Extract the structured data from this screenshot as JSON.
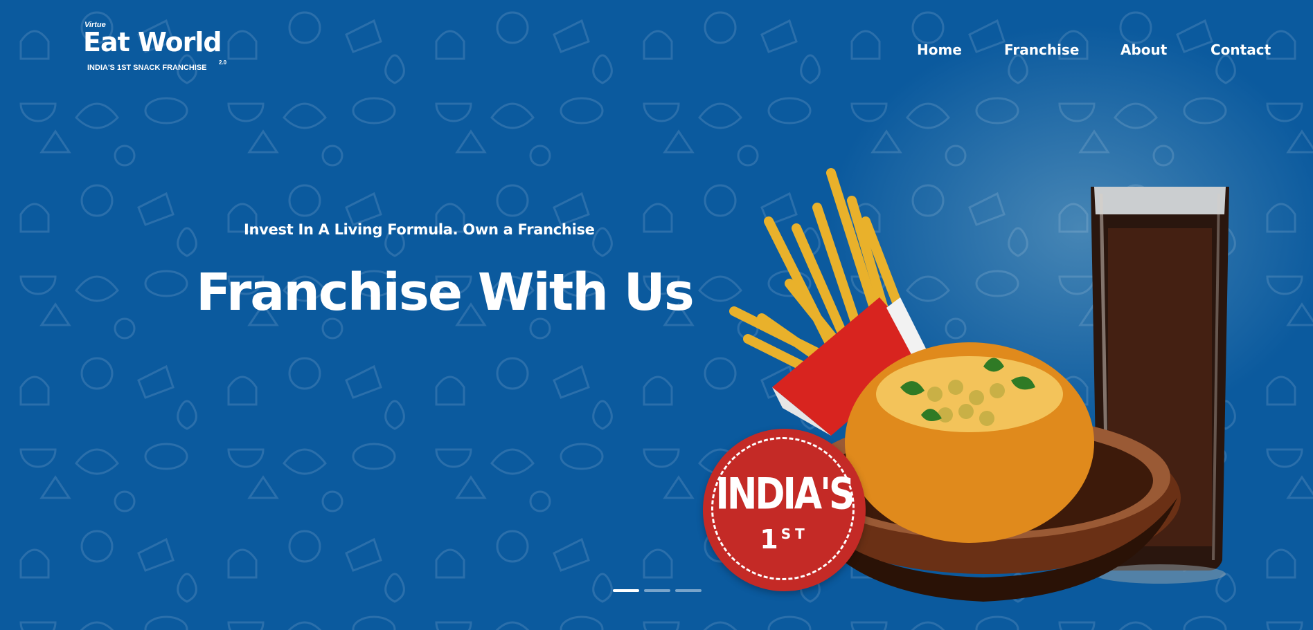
{
  "logo": {
    "top_word": "Virtue",
    "brand": "Eat World",
    "version": "2.0",
    "tagline": "INDIA'S 1ST SNACK FRANCHISE"
  },
  "nav": {
    "items": [
      {
        "label": "Home"
      },
      {
        "label": "Franchise"
      },
      {
        "label": "About"
      },
      {
        "label": "Contact"
      }
    ]
  },
  "hero": {
    "subtitle": "Invest In A Living Formula. Own a Franchise",
    "title": "Franchise With Us",
    "badge_line1": "INDIA'S",
    "badge_line2": "1",
    "badge_sup": "ST"
  },
  "slider": {
    "active_index": 0,
    "count": 3
  },
  "colors": {
    "background": "#0b5a9e",
    "badge": "#c42a26",
    "text": "#ffffff"
  },
  "icons": [
    "food-doodle-pattern",
    "fries-image",
    "drink-glass-image",
    "snack-bowl-image"
  ]
}
